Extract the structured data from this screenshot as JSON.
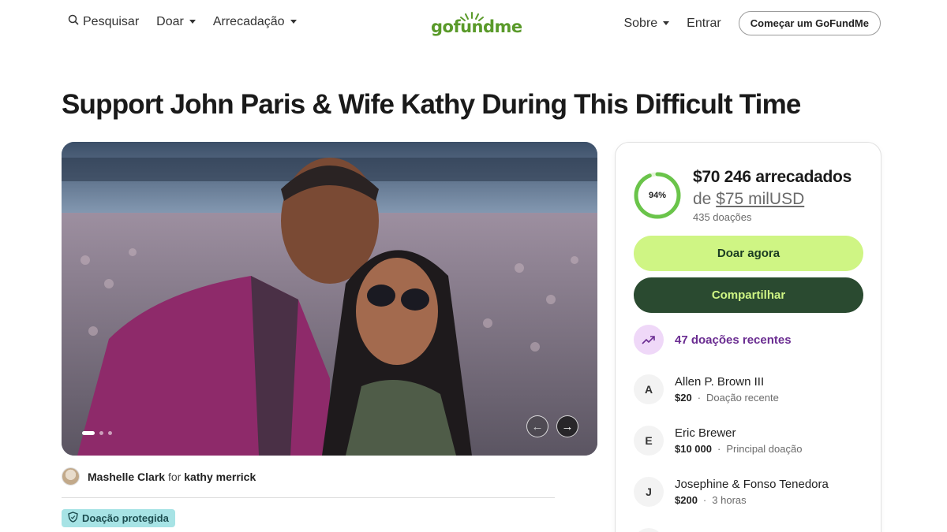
{
  "header": {
    "search_label": "Pesquisar",
    "donate_label": "Doar",
    "fundraise_label": "Arrecadação",
    "logo_text": "gofundme",
    "about_label": "Sobre",
    "signin_label": "Entrar",
    "start_button": "Começar um GoFundMe"
  },
  "campaign": {
    "title": "Support John Paris & Wife Kathy During This Difficult Time",
    "organizer_name": "Mashelle Clark",
    "organizer_for": "for",
    "beneficiary": "kathy merrick",
    "protected_label": "Doação protegida",
    "photo_description_icon": "photo"
  },
  "panel": {
    "percent": "94%",
    "percent_value": 0.94,
    "raised": "$70 246 arrecadados",
    "goal_prefix": "de",
    "goal_amount": "$75 milUSD",
    "donation_count": "435 doações",
    "donate_button": "Doar agora",
    "share_button": "Compartilhar",
    "recent_label": "47 doações recentes",
    "donors": [
      {
        "initial": "A",
        "name": "Allen P. Brown III",
        "amount": "$20",
        "note": "Doação recente"
      },
      {
        "initial": "E",
        "name": "Eric Brewer",
        "amount": "$10 000",
        "note": "Principal doação"
      },
      {
        "initial": "J",
        "name": "Josephine & Fonso Tenedora",
        "amount": "$200",
        "note": "3 horas"
      }
    ]
  },
  "colors": {
    "accent_green": "#cff584",
    "dark_green": "#2a4a30",
    "ring_green": "#6ac44a",
    "purple": "#6a2c91"
  }
}
